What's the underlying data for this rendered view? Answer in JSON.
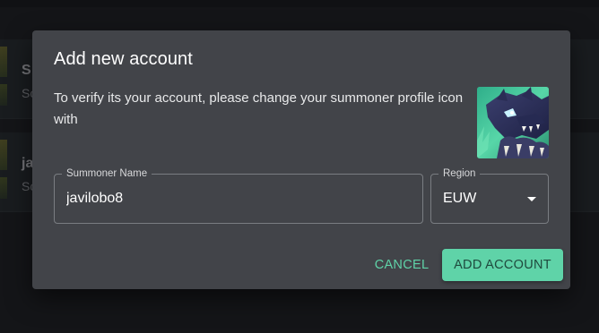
{
  "background": {
    "rows": [
      {
        "name": "S",
        "subtitle": "Sc"
      },
      {
        "name": "ja",
        "subtitle": "Sc"
      }
    ]
  },
  "modal": {
    "title": "Add new account",
    "description": "To verify its your account, please change your summoner profile icon with",
    "profile_icon": "werewolf-summoner-icon",
    "summoner_field": {
      "label": "Summoner Name",
      "value": "javilobo8"
    },
    "region_field": {
      "label": "Region",
      "value": "EUW"
    },
    "actions": {
      "cancel_label": "CANCEL",
      "add_label": "ADD ACCOUNT"
    }
  },
  "colors": {
    "accent": "#5fd3a8",
    "modal_bg": "#424449",
    "page_bg": "#1c1e21"
  }
}
